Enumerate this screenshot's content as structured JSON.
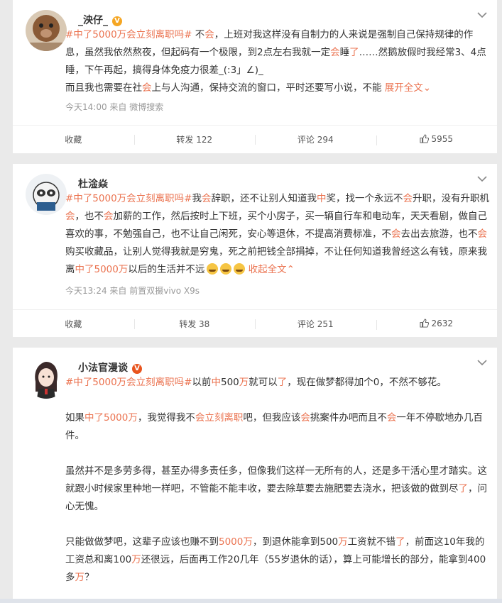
{
  "posts": [
    {
      "username": "_泱仔_",
      "badge": "V",
      "body_parts": [
        {
          "t": "tag",
          "v": "#中了5000万会立刻离职吗#"
        },
        {
          "t": "n",
          "v": " 不"
        },
        {
          "t": "k",
          "v": "会"
        },
        {
          "t": "n",
          "v": "，上班对我这样没有自制力的人来说是强制自己保持规律的作息，虽然我依然熬夜，但起码有一个极限，到2点左右我就一定"
        },
        {
          "t": "k",
          "v": "会"
        },
        {
          "t": "n",
          "v": "睡"
        },
        {
          "t": "k",
          "v": "了"
        },
        {
          "t": "n",
          "v": "……然鹅放假时我经常3、4点睡，下午再起，搞得身体免疫力很差_(:3」∠)_"
        },
        {
          "t": "br",
          "v": ""
        },
        {
          "t": "n",
          "v": "而且我也需要在社"
        },
        {
          "t": "k",
          "v": "会"
        },
        {
          "t": "n",
          "v": "上与人沟通，保持交流的窗口，平时还要写小说，不能 "
        },
        {
          "t": "link",
          "v": "展开全文"
        },
        {
          "t": "link",
          "v": "⌄"
        }
      ],
      "meta": "今天14:00  来自 微博搜索",
      "actions": {
        "fav": "收藏",
        "repost": "转发 122",
        "comment": "评论 294",
        "like": "5955"
      }
    },
    {
      "username": "杜淦焱",
      "body_parts": [
        {
          "t": "tag",
          "v": "#中了5000万会立刻离职吗#"
        },
        {
          "t": "n",
          "v": "我"
        },
        {
          "t": "k",
          "v": "会"
        },
        {
          "t": "n",
          "v": "辞职，还不让别人知道我"
        },
        {
          "t": "k",
          "v": "中"
        },
        {
          "t": "n",
          "v": "奖，找一个永远不"
        },
        {
          "t": "k",
          "v": "会"
        },
        {
          "t": "n",
          "v": "升职，没有升职机"
        },
        {
          "t": "k",
          "v": "会"
        },
        {
          "t": "n",
          "v": "，也不"
        },
        {
          "t": "k",
          "v": "会"
        },
        {
          "t": "n",
          "v": "加薪的工作，然后按时上下班，买个小房子，买一辆自行车和电动车，天天看剧，做自己喜欢的事，不勉强自己，也不让自己闲死，安心等退休，不提高消费标准，不"
        },
        {
          "t": "k",
          "v": "会"
        },
        {
          "t": "n",
          "v": "去出去旅游，也不"
        },
        {
          "t": "k",
          "v": "会"
        },
        {
          "t": "n",
          "v": "购买收藏品，让别人觉得我就是穷鬼，死之前把钱全部捐掉，不让任何知道我曾经这么有钱，原来我离"
        },
        {
          "t": "k",
          "v": "中了5000万"
        },
        {
          "t": "n",
          "v": "以后的生活并不远"
        },
        {
          "t": "emo",
          "v": ""
        },
        {
          "t": "emo",
          "v": ""
        },
        {
          "t": "emo",
          "v": ""
        },
        {
          "t": "n",
          "v": " "
        },
        {
          "t": "link",
          "v": "收起全文"
        },
        {
          "t": "link",
          "v": "⌃"
        }
      ],
      "meta": "今天13:24  来自 前置双摄vivo X9s",
      "actions": {
        "fav": "收藏",
        "repost": "转发 38",
        "comment": "评论 251",
        "like": "2632"
      }
    },
    {
      "username": "小法官漫谈",
      "badge": "V",
      "paragraphs": [
        [
          {
            "t": "tag",
            "v": "#中了5000万会立刻离职吗#"
          },
          {
            "t": "n",
            "v": "以前"
          },
          {
            "t": "k",
            "v": "中"
          },
          {
            "t": "n",
            "v": "500"
          },
          {
            "t": "k",
            "v": "万"
          },
          {
            "t": "n",
            "v": "就可以"
          },
          {
            "t": "k",
            "v": "了"
          },
          {
            "t": "n",
            "v": "，现在做梦都得加个0，不然不够花。"
          }
        ],
        [
          {
            "t": "n",
            "v": "如果"
          },
          {
            "t": "k",
            "v": "中了5000万"
          },
          {
            "t": "n",
            "v": "，我觉得我不"
          },
          {
            "t": "k",
            "v": "会立刻离职"
          },
          {
            "t": "n",
            "v": "吧，但我应该"
          },
          {
            "t": "k",
            "v": "会"
          },
          {
            "t": "n",
            "v": "挑案件办吧而且不"
          },
          {
            "t": "k",
            "v": "会"
          },
          {
            "t": "n",
            "v": "一年不停歇地办几百件。"
          }
        ],
        [
          {
            "t": "n",
            "v": "虽然并不是多劳多得，甚至办得多责任多，但像我们这样一无所有的人，还是多干活心里才踏实。这就跟小时候家里种地一样吧，不管能不能丰收，要去除草要去施肥要去浇水，把该做的做到尽"
          },
          {
            "t": "k",
            "v": "了"
          },
          {
            "t": "n",
            "v": "，问心无愧。"
          }
        ],
        [
          {
            "t": "n",
            "v": "只能做做梦吧，这辈子应该也赚不到"
          },
          {
            "t": "k",
            "v": "5000万"
          },
          {
            "t": "n",
            "v": "，到退休能拿到500"
          },
          {
            "t": "k",
            "v": "万"
          },
          {
            "t": "n",
            "v": "工资就不错"
          },
          {
            "t": "k",
            "v": "了"
          },
          {
            "t": "n",
            "v": "，前面这10年我的工资总和离100"
          },
          {
            "t": "k",
            "v": "万"
          },
          {
            "t": "n",
            "v": "还很远，后面再工作20几年（55岁退休的话），算上可能增长的部分，能拿到400多"
          },
          {
            "t": "k",
            "v": "万"
          },
          {
            "t": "n",
            "v": "？"
          }
        ]
      ]
    }
  ],
  "colors": {
    "accent": "#eb7350",
    "text": "#333333",
    "meta": "#999999",
    "bg": "#eaeaea"
  }
}
